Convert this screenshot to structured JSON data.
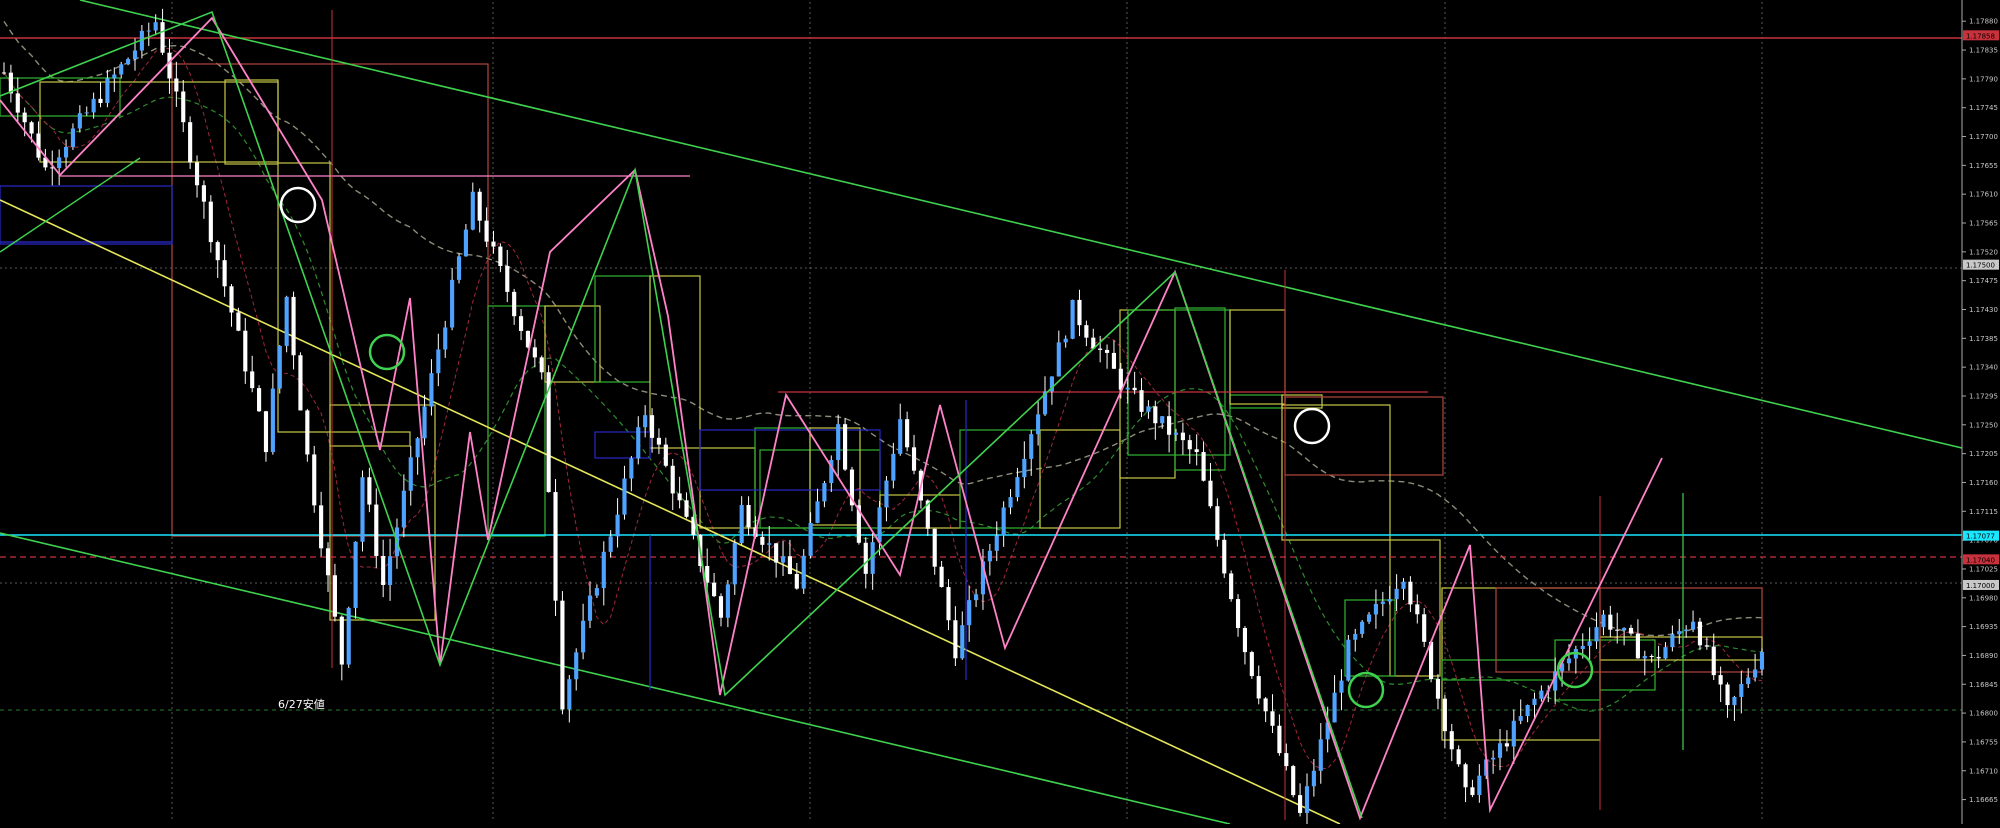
{
  "colors": {
    "background": "#000000",
    "grid": "#7f7f7f",
    "bull_body": "#4fa3ff",
    "bear_body": "#ffffff",
    "wick": "#ffffff",
    "trend_green": "#3fd24f",
    "trend_yellow": "#e6e65a",
    "zigzag_pink": "#ff82c8",
    "zigzag_green": "#3fd24f",
    "resistance_red": "#c8323c",
    "support_cyan": "#19e6ff",
    "box_yellow": "#c8c846",
    "box_green": "#32b432",
    "box_red": "#b4463c",
    "box_blue": "#2828c8",
    "ma_dashed": "#8c8c78",
    "ma_green_dashed": "#2e8b2e",
    "ma_red_dashed": "#a0283c"
  },
  "annotation": {
    "date_label": "6/27安値"
  },
  "chart_data": {
    "type": "candlestick",
    "title": "",
    "grid": true,
    "ylim": [
      1.1663,
      1.1791
    ],
    "y_ticks": [
      "1.17880",
      "1.17835",
      "1.17790",
      "1.17745",
      "1.17700",
      "1.17655",
      "1.17610",
      "1.17565",
      "1.17520",
      "1.17475",
      "1.17430",
      "1.17385",
      "1.17340",
      "1.17295",
      "1.17250",
      "1.17205",
      "1.17160",
      "1.17115",
      "1.17070",
      "1.17025",
      "1.16980",
      "1.16935",
      "1.16890",
      "1.16845",
      "1.16800",
      "1.16755",
      "1.16710",
      "1.16665"
    ],
    "price_tags": [
      {
        "value": 1.17858,
        "label": "1.17858",
        "color": "#c8323c"
      },
      {
        "value": 1.175,
        "label": "1.17500",
        "color": "#c8c8c8"
      },
      {
        "value": 1.17077,
        "label": "1.17077",
        "color": "#19e6ff"
      },
      {
        "value": 1.1704,
        "label": "1.17040",
        "color": "#c8323c"
      },
      {
        "value": 1.17,
        "label": "1.17000",
        "color": "#c8c8c8"
      }
    ],
    "pivots": [
      {
        "i": 0,
        "p": 1.178
      },
      {
        "i": 6,
        "p": 1.1765
      },
      {
        "i": 22,
        "p": 1.1788
      },
      {
        "i": 38,
        "p": 1.1722
      },
      {
        "i": 41,
        "p": 1.1745
      },
      {
        "i": 44,
        "p": 1.172
      },
      {
        "i": 49,
        "p": 1.1688
      },
      {
        "i": 52,
        "p": 1.1717
      },
      {
        "i": 55,
        "p": 1.17
      },
      {
        "i": 68,
        "p": 1.176
      },
      {
        "i": 78,
        "p": 1.1732
      },
      {
        "i": 81,
        "p": 1.1682
      },
      {
        "i": 93,
        "p": 1.1727
      },
      {
        "i": 104,
        "p": 1.1695
      },
      {
        "i": 107,
        "p": 1.1712
      },
      {
        "i": 115,
        "p": 1.17
      },
      {
        "i": 121,
        "p": 1.1725
      },
      {
        "i": 125,
        "p": 1.1702
      },
      {
        "i": 130,
        "p": 1.1726
      },
      {
        "i": 138,
        "p": 1.169
      },
      {
        "i": 155,
        "p": 1.1743
      },
      {
        "i": 163,
        "p": 1.173
      },
      {
        "i": 173,
        "p": 1.172
      },
      {
        "i": 180,
        "p": 1.169
      },
      {
        "i": 188,
        "p": 1.1664
      },
      {
        "i": 195,
        "p": 1.169
      },
      {
        "i": 203,
        "p": 1.1702
      },
      {
        "i": 212,
        "p": 1.1667
      },
      {
        "i": 222,
        "p": 1.1682
      },
      {
        "i": 232,
        "p": 1.1695
      },
      {
        "i": 239,
        "p": 1.1688
      },
      {
        "i": 245,
        "p": 1.1695
      },
      {
        "i": 250,
        "p": 1.168
      },
      {
        "i": 255,
        "p": 1.169
      }
    ],
    "candle_count": 256
  }
}
